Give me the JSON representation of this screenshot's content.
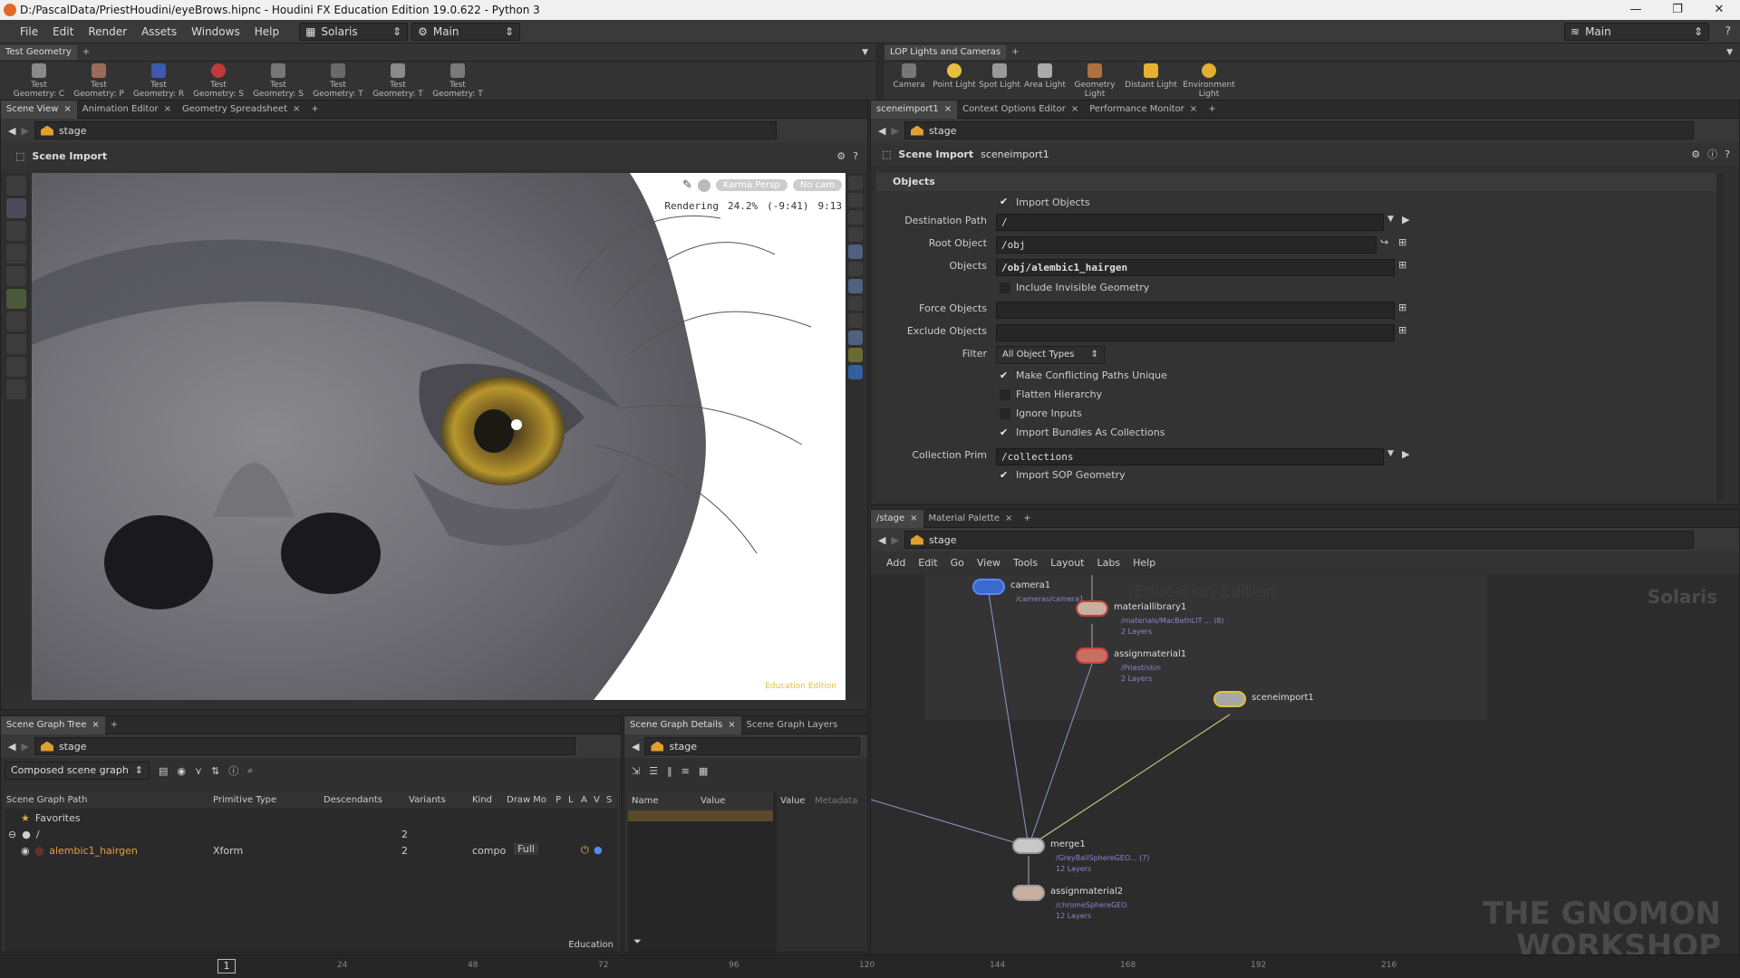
{
  "window": {
    "title": "D:/PascalData/PriestHoudini/eyeBrows.hipnc - Houdini FX Education Edition 19.0.622 - Python 3",
    "minimize": "—",
    "maximize": "❐",
    "close": "✕"
  },
  "menu": [
    "File",
    "Edit",
    "Render",
    "Assets",
    "Windows",
    "Help"
  ],
  "desktop": {
    "value": "Solaris"
  },
  "context": {
    "value": "Main"
  },
  "right_desktop": {
    "value": "Main"
  },
  "shelf_left": {
    "tab": "Test Geometry",
    "tools": [
      "Test Geometry: C",
      "Test Geometry: P",
      "Test Geometry: R",
      "Test Geometry: S",
      "Test Geometry: S",
      "Test Geometry: T",
      "Test Geometry: T",
      "Test Geometry: T"
    ]
  },
  "shelf_right": {
    "tab": "LOP Lights and Cameras",
    "tools": [
      "Camera",
      "Point Light",
      "Spot Light",
      "Area Light",
      "Geometry Light",
      "Distant Light",
      "Environment Light"
    ]
  },
  "viewer": {
    "tabs": [
      "Scene View",
      "Animation Editor",
      "Geometry Spreadsheet"
    ],
    "path": "stage",
    "title": "Scene Import",
    "camera": "Karma Persp",
    "nocam": "No cam",
    "render_label": "Rendering",
    "render_pct": "24.2%",
    "render_remaining": "(-9:41)",
    "render_elapsed": "9:13",
    "watermark": "Education Edition"
  },
  "params": {
    "tabs": [
      "sceneimport1",
      "Context Options Editor",
      "Performance Monitor"
    ],
    "path": "stage",
    "node_type": "Scene Import",
    "node_name": "sceneimport1",
    "section": "Objects",
    "import_objects": "Import Objects",
    "destination_path_label": "Destination Path",
    "destination_path": "/",
    "root_object_label": "Root Object",
    "root_object": "/obj",
    "objects_label": "Objects",
    "objects": "/obj/alembic1_hairgen",
    "include_invisible": "Include Invisible Geometry",
    "force_objects_label": "Force Objects",
    "exclude_objects_label": "Exclude Objects",
    "filter_label": "Filter",
    "filter_value": "All Object Types",
    "make_unique": "Make Conflicting Paths Unique",
    "flatten": "Flatten Hierarchy",
    "ignore_inputs": "Ignore Inputs",
    "import_bundles": "Import Bundles As Collections",
    "collection_prim_label": "Collection Prim",
    "collection_prim": "/collections",
    "import_sop": "Import SOP Geometry"
  },
  "network": {
    "tabs": [
      "/stage",
      "Material Palette"
    ],
    "path": "stage",
    "menu": [
      "Add",
      "Edit",
      "Go",
      "View",
      "Tools",
      "Layout",
      "Labs",
      "Help"
    ],
    "watermark_edu": "Education Edition",
    "watermark_ctx": "Solaris",
    "nodes": {
      "camera1": {
        "name": "camera1",
        "sub": "/cameras/camera1"
      },
      "materiallibrary1": {
        "name": "materiallibrary1",
        "sub": "/materials/MacBethLIT ... (8)",
        "layers": "2 Layers"
      },
      "assignmaterial1": {
        "name": "assignmaterial1",
        "sub": "/Priest/skin",
        "layers": "2 Layers"
      },
      "sceneimport1": {
        "name": "sceneimport1"
      },
      "merge1": {
        "name": "merge1",
        "sub": "/GreyBallSphereGEO... (7)",
        "layers": "12 Layers"
      },
      "assignmaterial2": {
        "name": "assignmaterial2",
        "sub": "/chromeSphereGEO",
        "layers": "12 Layers"
      }
    },
    "logo_top": "THE GNOMON",
    "logo_bottom": "WORKSHOP"
  },
  "scene_tree": {
    "tabs": [
      "Scene Graph Tree"
    ],
    "path": "stage",
    "mode": "Composed scene graph",
    "cols": [
      "Scene Graph Path",
      "Primitive Type",
      "Descendants",
      "Variants",
      "Kind",
      "Draw Mo",
      "P",
      "L",
      "A",
      "V",
      "S"
    ],
    "favorites": "Favorites",
    "root": "/",
    "root_desc": "2",
    "prim": "alembic1_hairgen",
    "prim_type": "Xform",
    "prim_desc": "2",
    "prim_kind": "compo",
    "prim_draw": "Full",
    "footer": "Education"
  },
  "details": {
    "tabs": [
      "Scene Graph Details",
      "Scene Graph Layers"
    ],
    "path": "stage",
    "col_name": "Name",
    "col_value": "Value",
    "value_tab": "Value",
    "metadata_tab": "Metadata"
  },
  "timeline": {
    "frame": "1",
    "ticks": [
      "24",
      "48",
      "72",
      "96",
      "120",
      "144",
      "168",
      "192",
      "216"
    ]
  }
}
